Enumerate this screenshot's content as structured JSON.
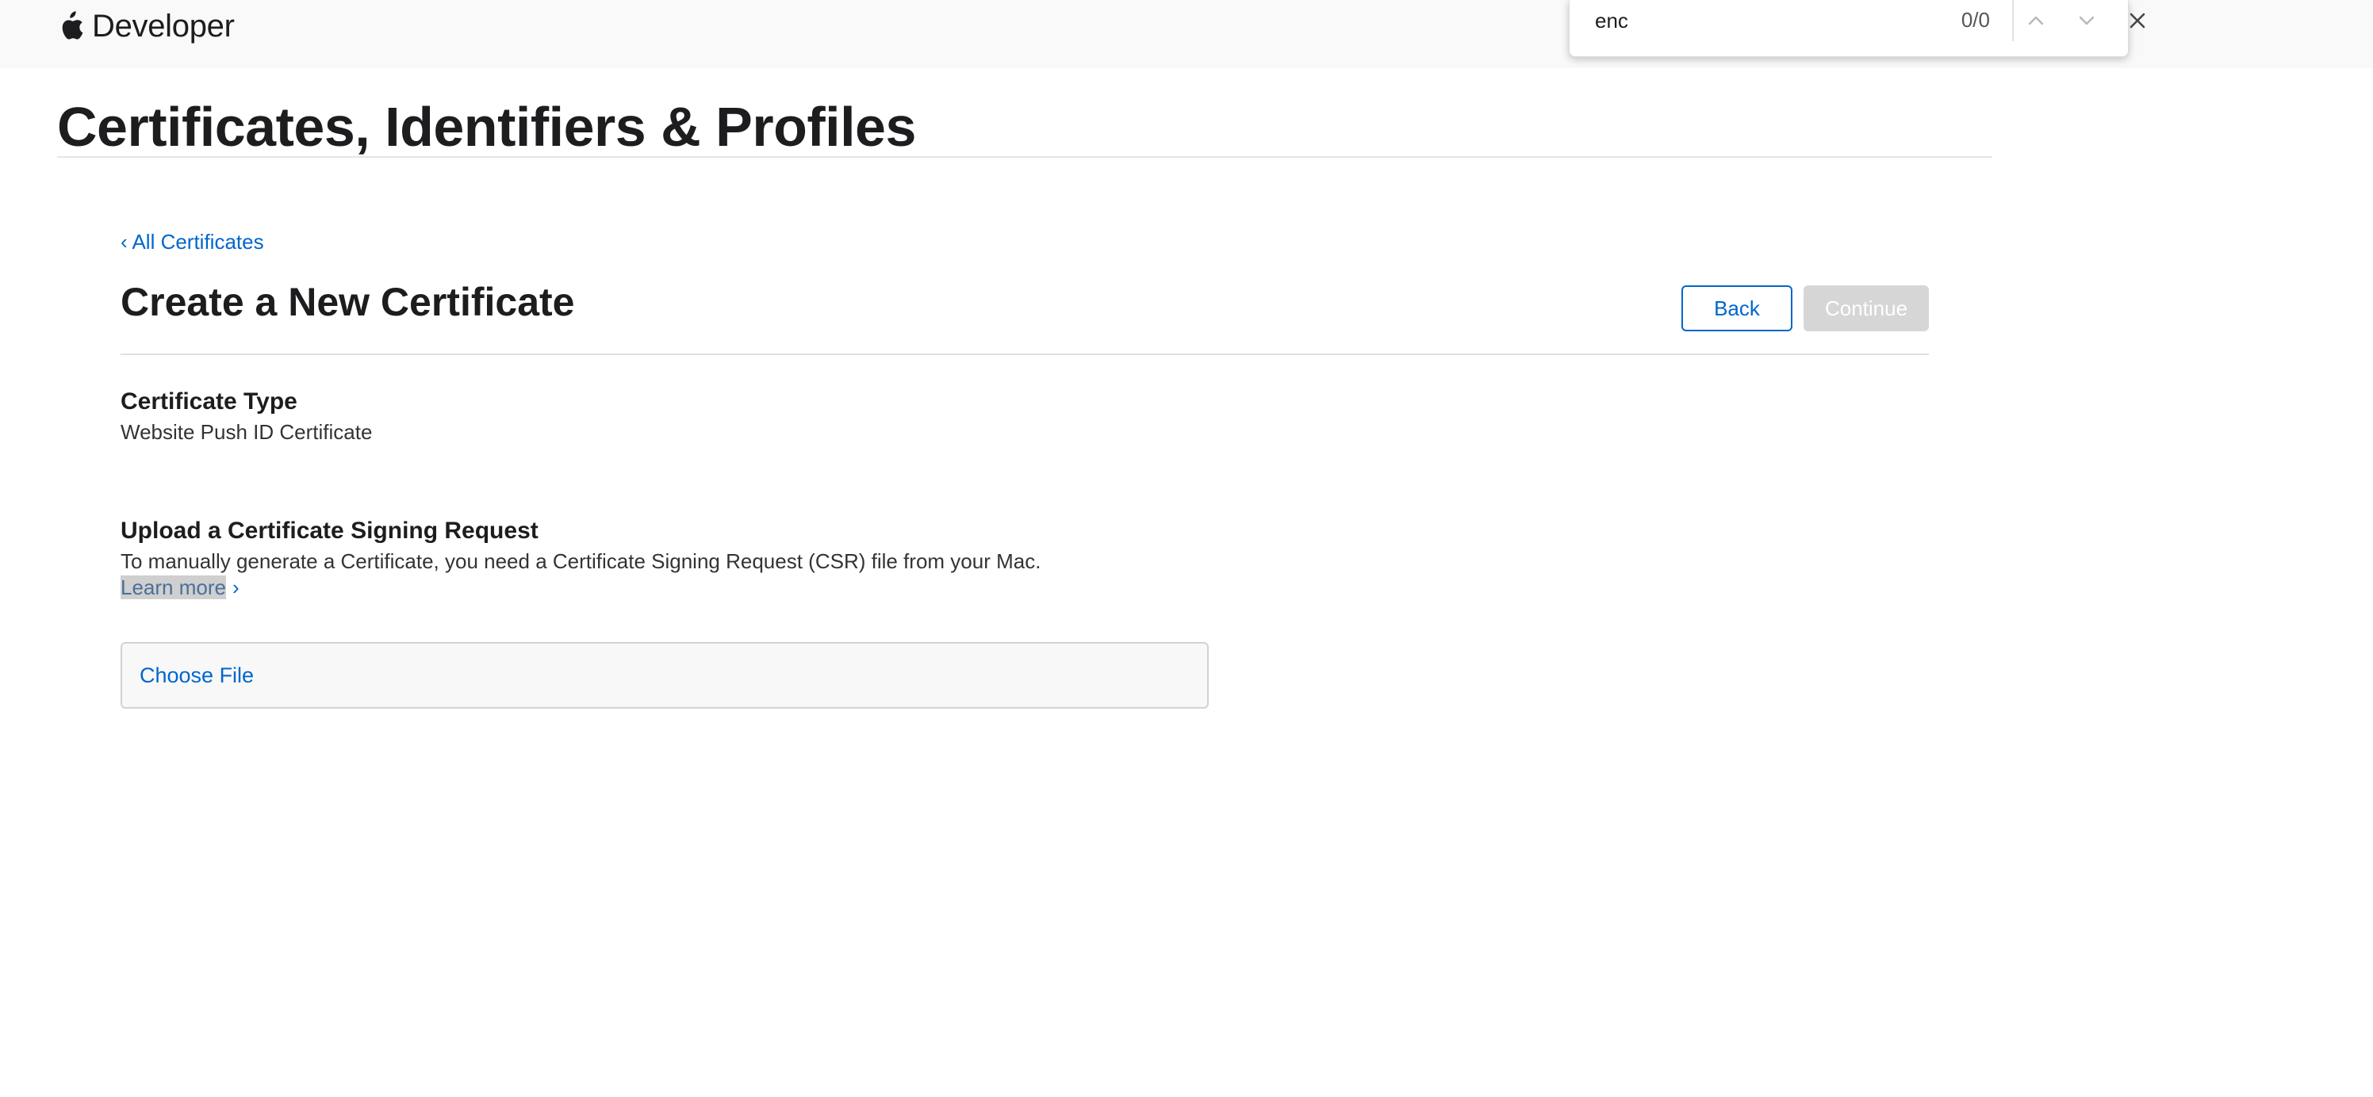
{
  "header": {
    "brand_label": "Developer"
  },
  "find_bar": {
    "query": "enc",
    "match_count": "0/0"
  },
  "page": {
    "title": "Certificates, Identifiers & Profiles"
  },
  "breadcrumb": {
    "back_label": "‹ All Certificates"
  },
  "form": {
    "title": "Create a New Certificate",
    "back_button": "Back",
    "continue_button": "Continue",
    "certificate_type_label": "Certificate Type",
    "certificate_type_value": "Website Push ID Certificate",
    "csr_label": "Upload a Certificate Signing Request",
    "csr_description": "To manually generate a Certificate, you need a Certificate Signing Request (CSR) file from your Mac.",
    "learn_more": "Learn more",
    "learn_more_chevron": "›",
    "choose_file": "Choose File"
  },
  "colors": {
    "link": "#0066cc",
    "disabled_button": "#d6d6d6",
    "text": "#1d1d1f"
  },
  "icons": [
    "apple-logo-icon",
    "chevron-up-icon",
    "chevron-down-icon",
    "close-icon"
  ]
}
